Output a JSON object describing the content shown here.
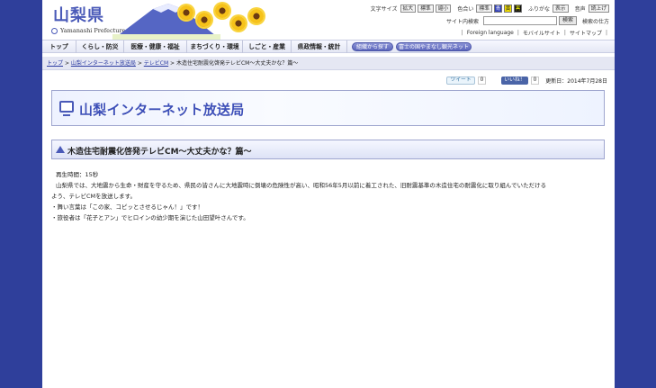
{
  "header": {
    "logo_kanji": "山梨県",
    "logo_sub": "Yamanashi Prefecture"
  },
  "tools": {
    "font_size_label": "文字サイズ",
    "font_buttons": [
      "拡大",
      "標準",
      "縮小"
    ],
    "color_label": "色合い",
    "color_buttons": [
      "標準",
      "青",
      "黄",
      "黒"
    ],
    "furigana_label": "ふりがな",
    "furigana_btn": "表示",
    "voice_label": "音声",
    "voice_btn": "読上げ",
    "site_search_label": "サイト内検索",
    "search_placeholder": "",
    "search_btn": "検索",
    "search_help": "検索の仕方",
    "links": [
      "Foreign language",
      "モバイルサイト",
      "サイトマップ"
    ]
  },
  "nav": {
    "items": [
      "トップ",
      "くらし・防災",
      "医療・健康・福祉",
      "まちづくり・環境",
      "しごと・産業",
      "県政情報・統計"
    ],
    "pills": [
      "組織から探す",
      "富士の国やまなし観光ネット"
    ]
  },
  "breadcrumb": {
    "items": [
      "トップ",
      "山梨インターネット放送局",
      "テレビCM"
    ],
    "current": "木造住宅耐震化啓発テレビCM～大丈夫かな？篇～"
  },
  "social": {
    "tweet": "ツイート",
    "tweet_count": "0",
    "like": "いいね！",
    "like_count": "0",
    "updated": "更新日：2014年7月28日"
  },
  "banner": {
    "title": "山梨インターネット放送局"
  },
  "section": {
    "title": "木造住宅耐震化啓発テレビCM～大丈夫かな？篇～"
  },
  "content": {
    "line1": "再生時間：15秒",
    "line2": "山梨県では、大地震から生命・財産を守るため、県民の皆さんに大地震時に倒壊の危険性が高い、昭和56年5月以前に着工された、旧耐震基準の木造住宅の耐震化に取り組んでいただける",
    "line3": "よう、テレビCMを放送します。",
    "line4": "・舞い言葉は「この家、コピッとさせるじゃん！」です！",
    "line5": "・旅役者は「花子とアン」でヒロインの幼少期を演じた山田望叶さんです。"
  }
}
